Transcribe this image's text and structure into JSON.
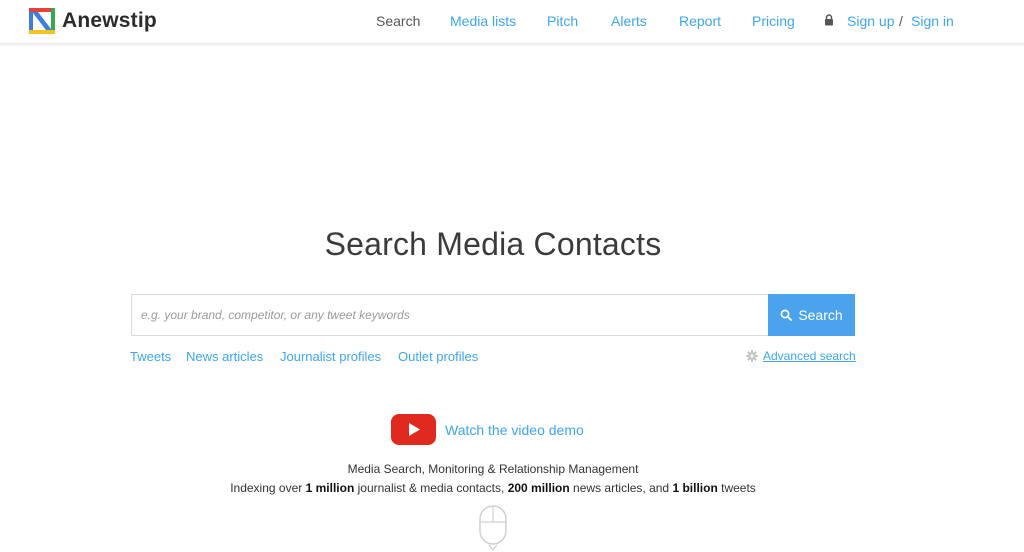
{
  "brand": {
    "name": "Anewstip",
    "colors": {
      "red": "#e8413a",
      "green": "#34a853",
      "yellow": "#f7c21c",
      "blue": "#3d7ce0"
    }
  },
  "nav": {
    "items": [
      {
        "label": "Search",
        "active": true
      },
      {
        "label": "Media lists"
      },
      {
        "label": "Pitch"
      },
      {
        "label": "Alerts"
      },
      {
        "label": "Report"
      },
      {
        "label": "Pricing"
      }
    ],
    "lock_icon": "lock-icon",
    "signup": "Sign up",
    "separator": "/",
    "signin": "Sign in"
  },
  "hero": {
    "title": "Search Media Contacts",
    "search": {
      "placeholder": "e.g. your brand, competitor, or any tweet keywords",
      "value": "",
      "button_label": "Search",
      "button_icon": "search-icon"
    },
    "filters": [
      {
        "label": "Tweets",
        "active": true
      },
      {
        "label": "News articles"
      },
      {
        "label": "Journalist profiles"
      },
      {
        "label": "Outlet profiles"
      }
    ],
    "advanced": {
      "label": "Advanced search",
      "icon": "gear-icon"
    }
  },
  "video": {
    "label": "Watch the video demo",
    "icon": "youtube-play-icon"
  },
  "tagline": "Media Search, Monitoring & Relationship Management",
  "stats": {
    "prefix": "Indexing over ",
    "journalists": "1 million",
    "mid1": " journalist & media contacts, ",
    "articles": "200 million",
    "mid2": " news articles, and ",
    "tweets": "1 billion",
    "suffix": " tweets"
  },
  "accent_color": "#3da6f0",
  "button_color": "#4aa3ec"
}
